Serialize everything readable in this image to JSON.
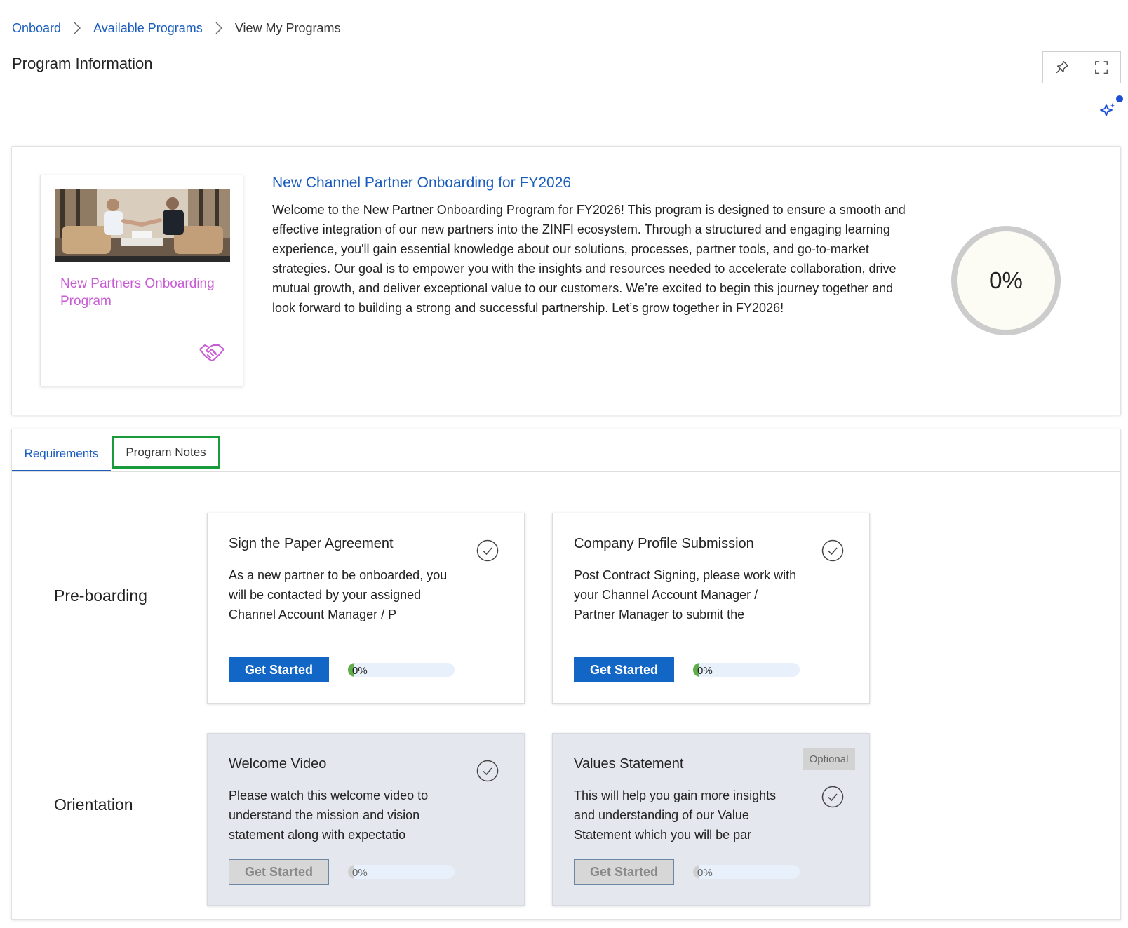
{
  "breadcrumb": {
    "items": [
      "Onboard",
      "Available Programs"
    ],
    "current": "View My Programs"
  },
  "header": {
    "title": "Program Information"
  },
  "program": {
    "card_title": "New Partners Onboarding Program",
    "title": "New Channel Partner Onboarding for FY2026",
    "description": "Welcome to the New Partner Onboarding Program for FY2026! This program is designed to ensure a smooth and effective integration of our new partners into the ZINFI ecosystem. Through a structured and engaging learning experience, you'll gain essential knowledge about our solutions, processes, partner tools, and go-to-market strategies. Our goal is to empower you with the insights and resources needed to accelerate collaboration, drive mutual growth, and deliver exceptional value to our customers. We’re excited to begin this journey together and look forward to building a strong and successful partnership. Let’s grow together in FY2026!",
    "progress_text": "0%",
    "progress_value": 0
  },
  "tabs": [
    {
      "label": "Requirements",
      "active": true
    },
    {
      "label": "Program Notes",
      "active": false
    }
  ],
  "phases": [
    {
      "name": "Pre-boarding",
      "requirements": [
        {
          "title": "Sign the Paper Agreement",
          "description": "As a new partner to be onboarded, you will be contacted by your assigned Channel Account Manager / P",
          "button": "Get Started",
          "progress_text": "0%",
          "progress": 0,
          "locked": false
        },
        {
          "title": "Company Profile Submission",
          "description": "Post Contract Signing, please work with your Channel Account Manager / Partner Manager to submit the",
          "button": "Get Started",
          "progress_text": "0%",
          "progress": 0,
          "locked": false
        }
      ]
    },
    {
      "name": "Orientation",
      "requirements": [
        {
          "title": "Welcome Video",
          "description": "Please watch this welcome video to understand the mission and vision statement along with expectatio",
          "button": "Get Started",
          "progress_text": "0%",
          "progress": 0,
          "locked": true
        },
        {
          "title": "Values Statement",
          "badge": "Optional",
          "description": "This will help you gain more insights and understanding of our Value Statement which you will be par",
          "button": "Get Started",
          "progress_text": "0%",
          "progress": 0,
          "locked": true
        }
      ]
    }
  ],
  "colors": {
    "link": "#1a5dbd",
    "primary_button": "#1266c6",
    "card_title": "#c95bd6",
    "highlight_border": "#1a9b3b",
    "progress_ring": "#cccccc"
  },
  "icons": [
    "chevron-right-icon",
    "pin-icon",
    "fullscreen-icon",
    "sparkle-icon",
    "handshake-icon",
    "check-circle-icon"
  ]
}
